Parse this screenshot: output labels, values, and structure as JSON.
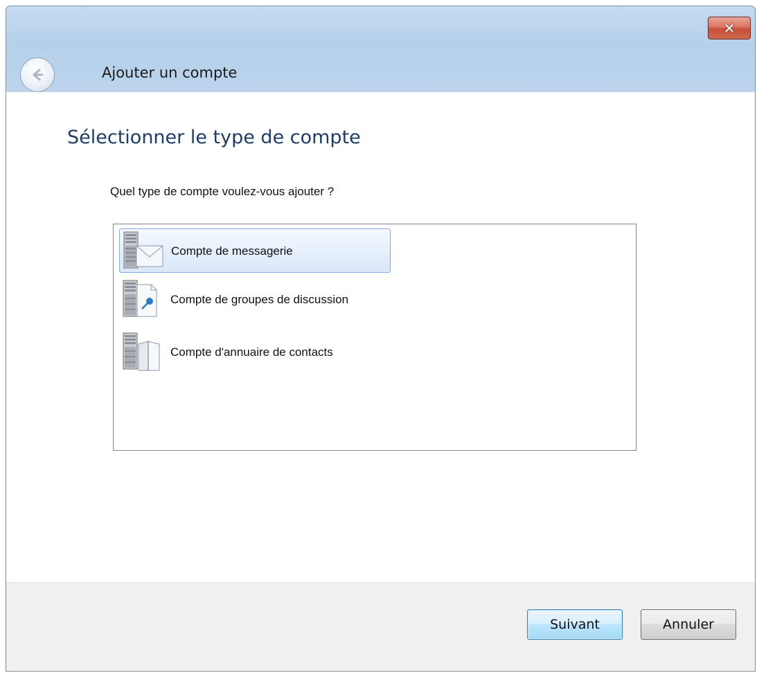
{
  "window": {
    "close_label": "✕",
    "header_title": "Ajouter un compte"
  },
  "main": {
    "heading": "Sélectionner le type de compte",
    "question": "Quel type de compte voulez-vous ajouter ?",
    "account_types": [
      {
        "label": "Compte de messagerie",
        "icon": "mail-server-icon",
        "selected": true
      },
      {
        "label": "Compte de groupes de discussion",
        "icon": "news-server-icon",
        "selected": false
      },
      {
        "label": "Compte d'annuaire de contacts",
        "icon": "directory-server-icon",
        "selected": false
      }
    ]
  },
  "footer": {
    "next_label": "Suivant",
    "cancel_label": "Annuler"
  },
  "colors": {
    "titlebar": "#bcd4ec",
    "heading": "#1e3d68",
    "selection_border": "#84acdd",
    "close_button": "#c74f37"
  }
}
